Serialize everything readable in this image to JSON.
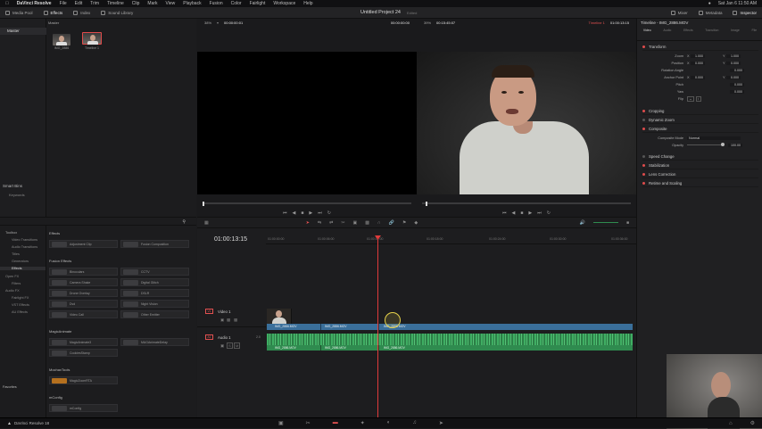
{
  "menubar": {
    "app_name": "DaVinci Resolve",
    "items": [
      "File",
      "Edit",
      "Trim",
      "Timeline",
      "Clip",
      "Mark",
      "View",
      "Playback",
      "Fusion",
      "Color",
      "Fairlight",
      "Workspace",
      "Help"
    ],
    "clock": "Sat Jan 6  11:50 AM"
  },
  "toolbar": {
    "media_pool": "Media Pool",
    "effects": "Effects",
    "index": "Index",
    "sound_library": "Sound Library",
    "project_title": "Untitled Project 24",
    "project_status": "Edited",
    "mixer": "Mixer",
    "metadata": "Metadata",
    "inspector": "Inspector"
  },
  "bins": {
    "master": "Master",
    "smart_bins": "Smart Bins",
    "keywords": "Keywords"
  },
  "source_viewer": {
    "zoom": "38%",
    "timecode": "00:00:00:01",
    "duration": "00:00:00:00"
  },
  "timeline_viewer": {
    "zoom": "39%",
    "duration": "00:15:45:07",
    "timeline_name": "Timeline 1",
    "timecode": "01:00:13:15"
  },
  "media_pool": {
    "clips": [
      {
        "label": "IMG_2886"
      },
      {
        "label": "Timeline 1"
      }
    ]
  },
  "fx_tree": {
    "toolbox": "Toolbox",
    "items": [
      "Video Transitions",
      "Audio Transitions",
      "Titles",
      "Generators",
      "Effects",
      "Open FX",
      "Filters",
      "Audio FX",
      "Fairlight FX",
      "VST Effects",
      "AU Effects"
    ],
    "favorites": "Favorites"
  },
  "fx_list": {
    "effects_header": "Effects",
    "effects_items": [
      "Adjustment Clip",
      "Fusion Composition"
    ],
    "fusion_header": "Fusion Effects",
    "fusion_items": [
      "Binoculars",
      "CCTV",
      "Camera Shake",
      "Digital Glitch",
      "Drone Overlay",
      "DSLR",
      "Dvd",
      "Night Vision",
      "Video Call",
      "Other Emitter"
    ],
    "magic_header": "MagicAnimate",
    "magic_items": [
      "MagicAnimate3",
      "MAGAnimateDelay",
      "CookiesStamp"
    ],
    "mochaka_header": "MochaxTools",
    "mochaka_items": [
      "MagicZoomRTA"
    ],
    "mzconfig_header": "mConfig",
    "mzconfig_items": [
      "mConfig"
    ]
  },
  "timeline": {
    "current_timecode": "01:00:13:15",
    "ruler": [
      "01:00:00:00",
      "01:00:06:00",
      "01:00:12:00",
      "01:00:18:00",
      "01:00:24:00",
      "01:00:30:00",
      "01:00:36:00"
    ],
    "video_track": {
      "label": "Video 1",
      "tag": "V1",
      "clip_name": "IMG_2886.MOV"
    },
    "audio_track": {
      "label": "Audio 1",
      "tag": "A1",
      "level": "2.0",
      "clip_name": "IMG_2886.MOV"
    }
  },
  "inspector": {
    "title": "Timeline - IMG_2886.MOV",
    "tabs": [
      "Video",
      "Audio",
      "Effects",
      "Transition",
      "Image",
      "File"
    ],
    "transform": "Transform",
    "zoom_label": "Zoom",
    "zoom_x": "1.000",
    "zoom_y": "1.000",
    "position_label": "Position",
    "position_x": "0.000",
    "position_y": "0.000",
    "rotation_label": "Rotation Angle",
    "rotation": "0.000",
    "anchor_label": "Anchor Point",
    "anchor_x": "0.000",
    "anchor_y": "0.000",
    "pitch_label": "Pitch",
    "pitch": "0.000",
    "yaw_label": "Yaw",
    "yaw": "0.000",
    "flip_label": "Flip",
    "cropping": "Cropping",
    "dynamic_zoom": "Dynamic Zoom",
    "composite": "Composite",
    "composite_mode_label": "Composite Mode",
    "composite_mode": "Normal",
    "opacity_label": "Opacity",
    "opacity": "100.00",
    "speed_change": "Speed Change",
    "stabilization": "Stabilization",
    "lens_correction": "Lens Correction",
    "retime": "Retime and Scaling"
  },
  "pagebar": {
    "app_label": "DaVinci Resolve 18"
  },
  "colors": {
    "playhead": "#e03b3b",
    "video_clip": "#3a6f9a",
    "audio_clip": "#2f8b4f",
    "accent": "#e05050"
  }
}
